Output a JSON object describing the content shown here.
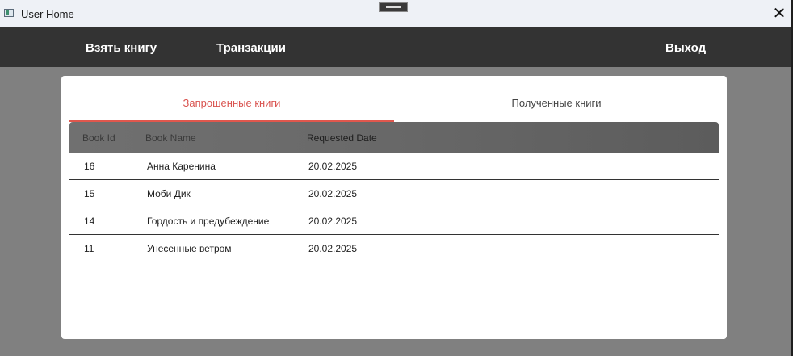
{
  "window": {
    "title": "User Home",
    "close_icon": "close-icon"
  },
  "nav": {
    "take_book": "Взять книгу",
    "transactions": "Транзакции",
    "exit": "Выход"
  },
  "tabs": [
    {
      "label": "Запрошенные книги",
      "active": true
    },
    {
      "label": "Полученные книги",
      "active": false
    }
  ],
  "table": {
    "headers": {
      "id": "Book Id",
      "name": "Book Name",
      "date": "Requested Date"
    },
    "rows": [
      {
        "id": "16",
        "name": "Анна Каренина",
        "date": "20.02.2025"
      },
      {
        "id": "15",
        "name": "Моби Дик",
        "date": "20.02.2025"
      },
      {
        "id": "14",
        "name": "Гордость и предубеждение",
        "date": "20.02.2025"
      },
      {
        "id": "11",
        "name": "Унесенные ветром",
        "date": "20.02.2025"
      }
    ]
  },
  "colors": {
    "accent": "#e0574d",
    "navbar": "#333333",
    "backdrop": "#808080"
  }
}
